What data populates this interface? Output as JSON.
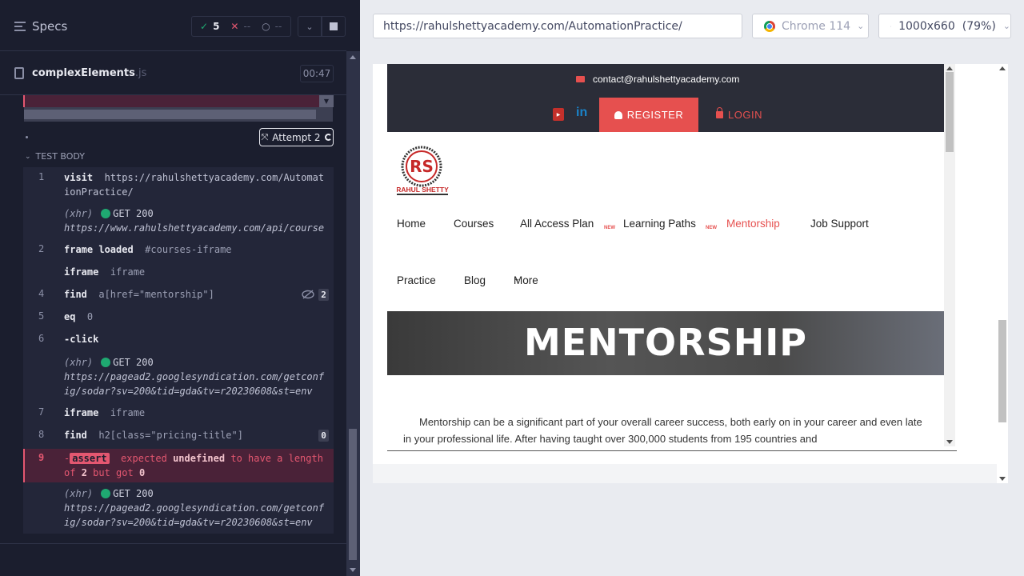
{
  "runner": {
    "specs_label": "Specs",
    "passed_count": "5",
    "failed_count": "--",
    "pending_count": "--",
    "spec_name": "complexElements",
    "spec_ext": ".js",
    "duration": "00:47",
    "attempt_label": "Attempt 2",
    "test_body_label": "TEST BODY"
  },
  "commands": [
    {
      "num": "1",
      "name": "visit",
      "msg": "https://rahulshettyacademy.com/AutomationPractice/"
    },
    {
      "xhr": "(xhr)",
      "status": "GET 200",
      "url": "https://www.rahulshettyacademy.com/api/course"
    },
    {
      "num": "2",
      "name": "frame loaded",
      "msg": "#courses-iframe"
    },
    {
      "name": "iframe",
      "msg": "iframe"
    },
    {
      "num": "4",
      "name": "find",
      "msg": "a[href=\"mentorship\"]",
      "badge": "2"
    },
    {
      "num": "5",
      "name": "eq",
      "msg": "0"
    },
    {
      "num": "6",
      "name": "-click",
      "msg": ""
    },
    {
      "xhr": "(xhr)",
      "status": "GET 200",
      "url": "https://pagead2.googlesyndication.com/getconfig/sodar?sv=200&tid=gda&tv=r20230608&st=env"
    },
    {
      "num": "7",
      "name": "iframe",
      "msg": "iframe"
    },
    {
      "num": "8",
      "name": "find",
      "msg": "h2[class=\"pricing-title\"]",
      "badge": "0"
    },
    {
      "num": "9",
      "assert_label": "assert",
      "err_parts": [
        "expected",
        "undefined",
        "to have a length of",
        "2",
        "but got",
        "0"
      ]
    },
    {
      "xhr": "(xhr)",
      "status": "GET 200",
      "url": "https://pagead2.googlesyndication.com/getconfig/sodar?sv=200&tid=gda&tv=r20230608&st=env"
    }
  ],
  "browser": {
    "url": "https://rahulshettyacademy.com/AutomationPractice/",
    "browser_name": "Chrome 114",
    "viewport": "1000x660",
    "viewport_display": "1000x660",
    "zoom": "(79%)"
  },
  "site": {
    "contact_email": "contact@rahulshettyacademy.com",
    "register_label": "REGISTER",
    "login_label": "LOGIN",
    "logo_text": "RAHUL SHETTY",
    "nav": [
      "Home",
      "Courses",
      "All Access Plan",
      "Learning Paths",
      "Mentorship",
      "Job Support",
      "Practice",
      "Blog",
      "More"
    ],
    "new_tag": "NEW",
    "banner_title": "MENTORSHIP",
    "paragraph": "Mentorship can be a significant part of your overall career success, both early on in your career and even late in your professional life. After having taught over 300,000 students from 195 countries and"
  },
  "colors": {
    "accent": "#e6504f",
    "runner_bg": "#1b1e2e",
    "pass": "#1fa971",
    "fail": "#e45770"
  }
}
